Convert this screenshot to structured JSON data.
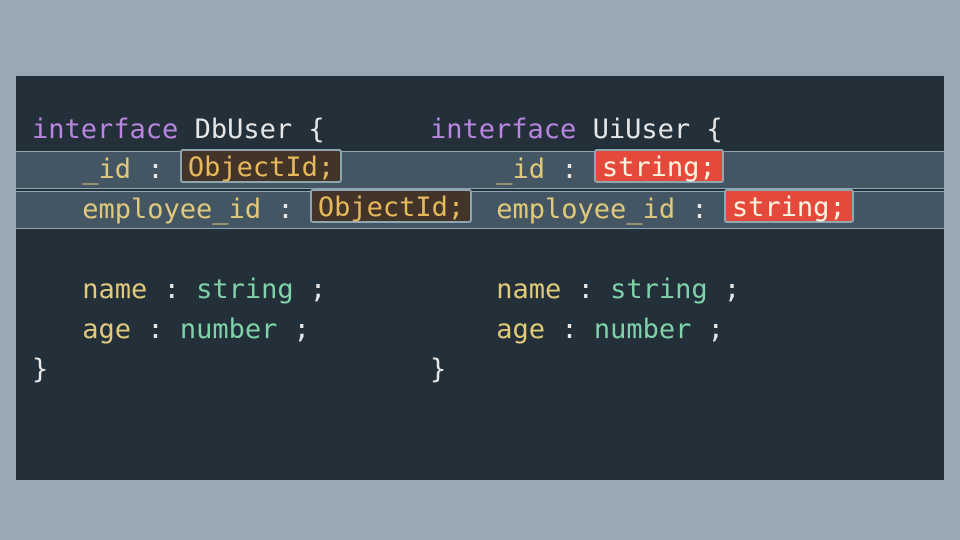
{
  "left": {
    "iface_kw": "interface",
    "iface_name": "DbUser",
    "open": "{",
    "close": "}",
    "id_prop": "_id",
    "id_diff": "ObjectId;",
    "emp_prop": "employee_id",
    "emp_diff": "ObjectId;",
    "name_prop": "name",
    "name_type": "string",
    "age_prop": "age",
    "age_type": "number"
  },
  "right": {
    "iface_kw": "interface",
    "iface_name": "UiUser",
    "open": "{",
    "close": "}",
    "id_prop": "_id",
    "id_diff": "string;",
    "emp_prop": "employee_id",
    "emp_diff": "string;",
    "name_prop": "name",
    "name_type": "string",
    "age_prop": "age",
    "age_type": "number"
  },
  "colon": ":",
  "semi": ";"
}
